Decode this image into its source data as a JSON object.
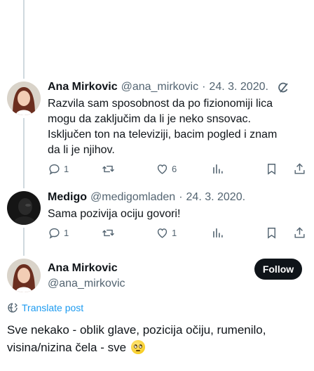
{
  "tweet1": {
    "name": "Ana Mirkovic",
    "handle": "@ana_mirkovic",
    "separator": "·",
    "date": "24. 3. 2020.",
    "text": "Razvila sam sposobnost da po fizionomiji lica mogu da zaključim da li je neko snsovac. Isključen ton na televiziji, bacim pogled i znam da li je njihov.",
    "replies": "1",
    "retweets": "",
    "likes": "6"
  },
  "tweet2": {
    "name": "Medigo",
    "handle": "@medigomladen",
    "separator": "·",
    "date": "24. 3. 2020.",
    "text": "Sama pozivija ociju govori!",
    "replies": "1",
    "retweets": "",
    "likes": "1"
  },
  "main": {
    "name": "Ana Mirkovic",
    "handle": "@ana_mirkovic",
    "follow_label": "Follow",
    "translate_label": "Translate post",
    "text": "Sve nekako - oblik glave, pozicija očiju, rumenilo, visina/nizina čela - sve"
  },
  "icons": {
    "grok": "grok-icon",
    "reply": "reply-icon",
    "retweet": "retweet-icon",
    "like": "heart-icon",
    "views": "views-icon",
    "bookmark": "bookmark-icon",
    "share": "share-icon",
    "emoji": "face-with-rolling-eyes-emoji"
  },
  "colors": {
    "accent": "#1d9bf0",
    "text": "#0f1419",
    "muted": "#536471"
  }
}
